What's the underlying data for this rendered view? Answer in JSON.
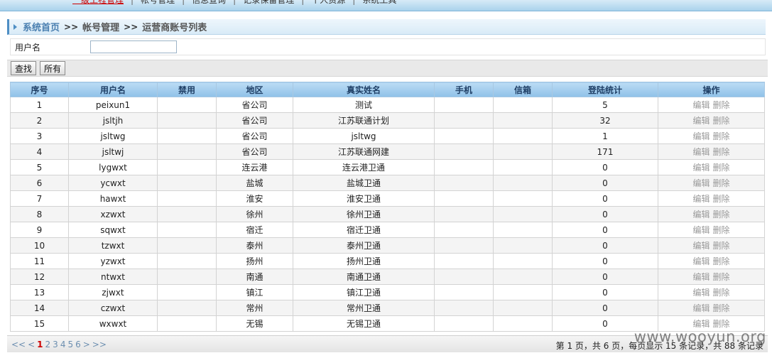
{
  "topnav": {
    "items": [
      "一级工程管理",
      "帐号管理",
      "信息查询",
      "记录保留管理",
      "个人资源",
      "系统工具"
    ],
    "active_index": 0
  },
  "breadcrumb": {
    "home": "系统首页",
    "sep": ">>",
    "level2": "帐号管理",
    "level3": "运营商账号列表"
  },
  "search": {
    "username_label": "用户名",
    "username_value": ""
  },
  "buttons": {
    "find": "查找",
    "all": "所有"
  },
  "table": {
    "headers": [
      "序号",
      "用户名",
      "禁用",
      "地区",
      "真实姓名",
      "手机",
      "信箱",
      "登陆统计",
      "操作"
    ],
    "edit_label": "编辑",
    "delete_label": "删除",
    "rows": [
      {
        "id": "1",
        "user": "peixun1",
        "disabled": "",
        "region": "省公司",
        "name": "测试",
        "phone": "",
        "email": "",
        "logins": "5"
      },
      {
        "id": "2",
        "user": "jsltjh",
        "disabled": "",
        "region": "省公司",
        "name": "江苏联通计划",
        "phone": "",
        "email": "",
        "logins": "32"
      },
      {
        "id": "3",
        "user": "jsltwg",
        "disabled": "",
        "region": "省公司",
        "name": "jsltwg",
        "phone": "",
        "email": "",
        "logins": "1"
      },
      {
        "id": "4",
        "user": "jsltwj",
        "disabled": "",
        "region": "省公司",
        "name": "江苏联通网建",
        "phone": "",
        "email": "",
        "logins": "171"
      },
      {
        "id": "5",
        "user": "lygwxt",
        "disabled": "",
        "region": "连云港",
        "name": "连云港卫通",
        "phone": "",
        "email": "",
        "logins": "0"
      },
      {
        "id": "6",
        "user": "ycwxt",
        "disabled": "",
        "region": "盐城",
        "name": "盐城卫通",
        "phone": "",
        "email": "",
        "logins": "0"
      },
      {
        "id": "7",
        "user": "hawxt",
        "disabled": "",
        "region": "淮安",
        "name": "淮安卫通",
        "phone": "",
        "email": "",
        "logins": "0"
      },
      {
        "id": "8",
        "user": "xzwxt",
        "disabled": "",
        "region": "徐州",
        "name": "徐州卫通",
        "phone": "",
        "email": "",
        "logins": "0"
      },
      {
        "id": "9",
        "user": "sqwxt",
        "disabled": "",
        "region": "宿迁",
        "name": "宿迁卫通",
        "phone": "",
        "email": "",
        "logins": "0"
      },
      {
        "id": "10",
        "user": "tzwxt",
        "disabled": "",
        "region": "泰州",
        "name": "泰州卫通",
        "phone": "",
        "email": "",
        "logins": "0"
      },
      {
        "id": "11",
        "user": "yzwxt",
        "disabled": "",
        "region": "扬州",
        "name": "扬州卫通",
        "phone": "",
        "email": "",
        "logins": "0"
      },
      {
        "id": "12",
        "user": "ntwxt",
        "disabled": "",
        "region": "南通",
        "name": "南通卫通",
        "phone": "",
        "email": "",
        "logins": "0"
      },
      {
        "id": "13",
        "user": "zjwxt",
        "disabled": "",
        "region": "镇江",
        "name": "镇江卫通",
        "phone": "",
        "email": "",
        "logins": "0"
      },
      {
        "id": "14",
        "user": "czwxt",
        "disabled": "",
        "region": "常州",
        "name": "常州卫通",
        "phone": "",
        "email": "",
        "logins": "0"
      },
      {
        "id": "15",
        "user": "wxwxt",
        "disabled": "",
        "region": "无锡",
        "name": "无锡卫通",
        "phone": "",
        "email": "",
        "logins": "0"
      }
    ]
  },
  "pager": {
    "first": "<<",
    "prev": "<",
    "pages": [
      "1",
      "2",
      "3",
      "4",
      "5",
      "6"
    ],
    "current": "1",
    "next": ">",
    "last": ">>",
    "summary": "第 1 页，共 6 页，每页显示 15 条记录，共 88 条记录"
  },
  "watermark": "www.wooyun.org"
}
